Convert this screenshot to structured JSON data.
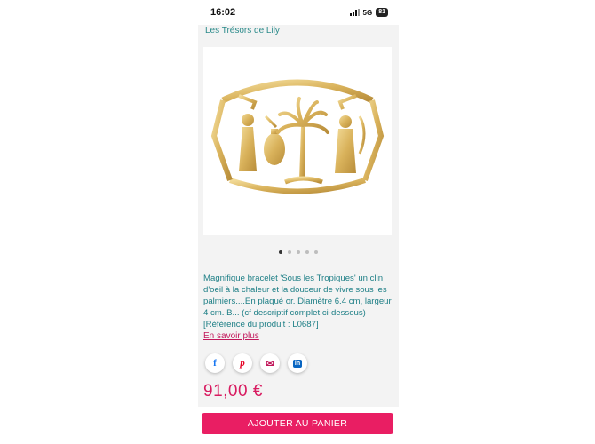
{
  "status_bar": {
    "time": "16:02",
    "network": "5G",
    "battery": "81"
  },
  "shop": {
    "name": "Les Trésors de Lily"
  },
  "product": {
    "image_alt": "Bracelet doré motif palmier et personnages",
    "carousel": {
      "count": 5,
      "active": 1
    },
    "description": "Magnifique bracelet 'Sous les Tropiques' un clin d'oeil à la chaleur et la douceur de vivre sous les palmiers....En plaqué or. Diamètre 6.4 cm, largeur 4 cm. B... (cf descriptif complet ci-dessous) [Référence du produit : L0687]",
    "more_link": "En savoir plus",
    "price": "91,00 €"
  },
  "share": [
    {
      "icon": "facebook-icon",
      "glyph": "f"
    },
    {
      "icon": "pinterest-icon",
      "glyph": "p"
    },
    {
      "icon": "email-icon",
      "glyph": "✉"
    },
    {
      "icon": "linkedin-icon",
      "glyph": "in"
    }
  ],
  "cart": {
    "label": "AJOUTER AU PANIER"
  },
  "colors": {
    "accent": "#e91e63",
    "teal": "#1e7f86",
    "price": "#d81b60"
  }
}
